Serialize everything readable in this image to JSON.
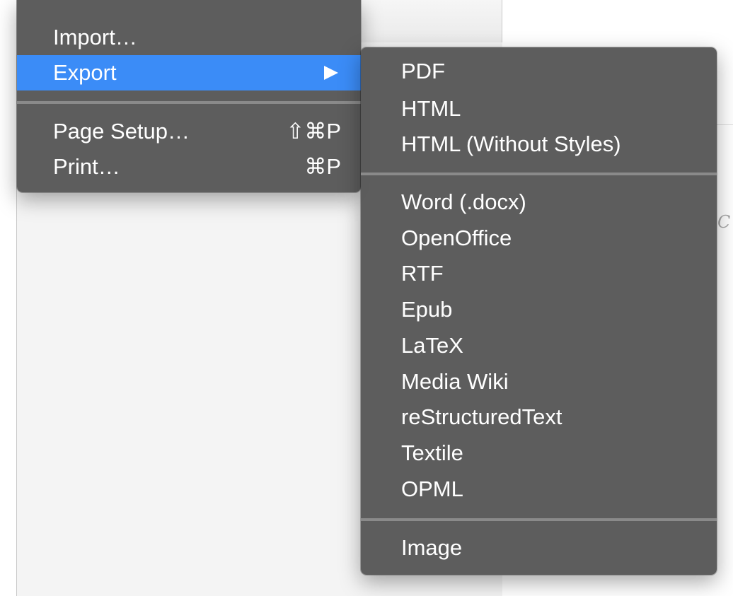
{
  "background": {
    "doc_glyph": "C"
  },
  "main_menu": {
    "items": [
      {
        "label": "Import…",
        "shortcut": ""
      },
      {
        "label": "Export",
        "shortcut": ""
      },
      {
        "label": "Page Setup…",
        "shortcut": "⇧⌘P"
      },
      {
        "label": "Print…",
        "shortcut": "⌘P"
      }
    ],
    "highlighted": "Export"
  },
  "export_menu": {
    "groups": [
      [
        "PDF",
        "HTML",
        "HTML (Without Styles)"
      ],
      [
        "Word (.docx)",
        "OpenOffice",
        "RTF",
        "Epub",
        "LaTeX",
        "Media Wiki",
        "reStructuredText",
        "Textile",
        "OPML"
      ],
      [
        "Image"
      ]
    ]
  },
  "colors": {
    "menu_bg": "#585858",
    "highlight": "#3b8cf7",
    "separator": "#8a8a8a",
    "text": "#ffffff"
  }
}
